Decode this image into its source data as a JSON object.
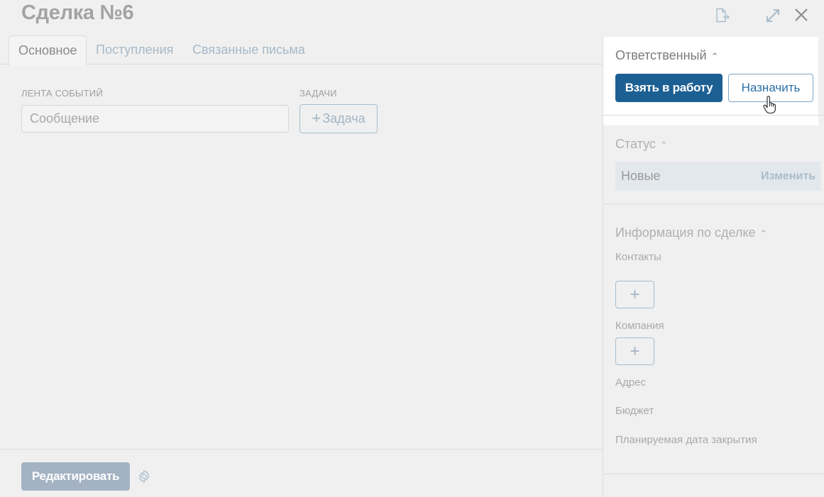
{
  "header": {
    "title": "Сделка №6",
    "icons": [
      "export-icon",
      "expand-icon",
      "close-icon"
    ]
  },
  "tabs": [
    {
      "label": "Основное",
      "active": true
    },
    {
      "label": "Поступления",
      "active": false
    },
    {
      "label": "Связанные письма",
      "active": false
    }
  ],
  "main": {
    "feed_label": "Лента событий",
    "message_placeholder": "Сообщение",
    "tasks_label": "Задачи",
    "task_button_label": "Задача"
  },
  "footer": {
    "edit_label": "Редактировать"
  },
  "sidebar": {
    "responsible": {
      "title": "Ответственный",
      "take_label": "Взять в работу",
      "assign_label": "Назначить"
    },
    "status": {
      "title": "Статус",
      "value": "Новые",
      "change_label": "Изменить"
    },
    "info": {
      "title": "Информация по сделке",
      "contacts_label": "Контакты",
      "company_label": "Компания",
      "address_label": "Адрес",
      "budget_label": "Бюджет",
      "close_date_label": "Планируемая дата закрытия"
    }
  },
  "colors": {
    "primary": "#1c5f93",
    "muted_accent": "#a9bccb",
    "disabled_button": "#a3b3c3"
  }
}
